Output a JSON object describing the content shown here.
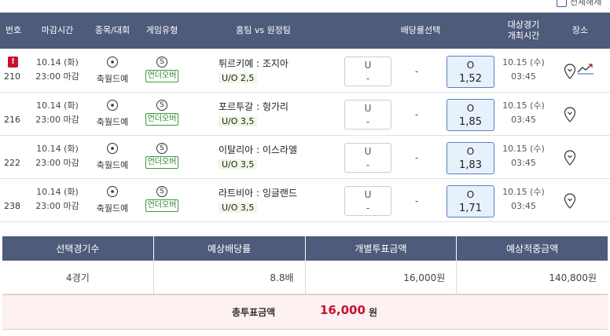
{
  "top_checkbox": {
    "label": "전체해제"
  },
  "headers": {
    "no": "번호",
    "deadline": "마감시간",
    "sport": "종목/대회",
    "game_type": "게임유형",
    "match": "홈팀 vs 원정팀",
    "odds_select": "배당률선택",
    "event_time_1": "대상경기",
    "event_time_2": "개최시간",
    "venue": "장소"
  },
  "rows": [
    {
      "alert": "!",
      "no": "210",
      "date": "10.14 (화)",
      "time": "23:00 마감",
      "sport": "축월드예",
      "type_icon": "S",
      "type": "언더오버",
      "teams": "튀르키예 : 조지아",
      "uo": "U/O 2,5",
      "u_label": "U",
      "u_val": "-",
      "mid": "-",
      "o_label": "O",
      "o_val": "1,52",
      "edate": "10.15 (수)",
      "etime": "03:45"
    },
    {
      "alert": "",
      "no": "216",
      "date": "10.14 (화)",
      "time": "23:00 마감",
      "sport": "축월드예",
      "type_icon": "S",
      "type": "언더오버",
      "teams": "포르투갈 : 헝가리",
      "uo": "U/O 3,5",
      "u_label": "U",
      "u_val": "-",
      "mid": "-",
      "o_label": "O",
      "o_val": "1,85",
      "edate": "10.15 (수)",
      "etime": "03:45"
    },
    {
      "alert": "",
      "no": "222",
      "date": "10.14 (화)",
      "time": "23:00 마감",
      "sport": "축월드예",
      "type_icon": "S",
      "type": "언더오버",
      "teams": "이탈리아 : 이스라엘",
      "uo": "U/O 3,5",
      "u_label": "U",
      "u_val": "-",
      "mid": "-",
      "o_label": "O",
      "o_val": "1,83",
      "edate": "10.15 (수)",
      "etime": "03:45"
    },
    {
      "alert": "",
      "no": "238",
      "date": "10.14 (화)",
      "time": "23:00 마감",
      "sport": "축월드예",
      "type_icon": "S",
      "type": "언더오버",
      "teams": "라트비아 : 잉글랜드",
      "uo": "U/O 3,5",
      "u_label": "U",
      "u_val": "-",
      "mid": "-",
      "o_label": "O",
      "o_val": "1,71",
      "edate": "10.15 (수)",
      "etime": "03:45"
    }
  ],
  "summary": {
    "headers": [
      "선택경기수",
      "예상배당률",
      "개별투표금액",
      "예상적중금액"
    ],
    "values": [
      "4경기",
      "8.8배",
      "16,000원",
      "140,800원"
    ]
  },
  "total": {
    "label": "총투표금액",
    "value": "16,000",
    "unit": "원"
  },
  "colors": {
    "header_bg": "#4e5b7a",
    "accent_red": "#c8102e",
    "selected_bg": "#e7f1fc",
    "badge_green": "#3a9a3a"
  }
}
